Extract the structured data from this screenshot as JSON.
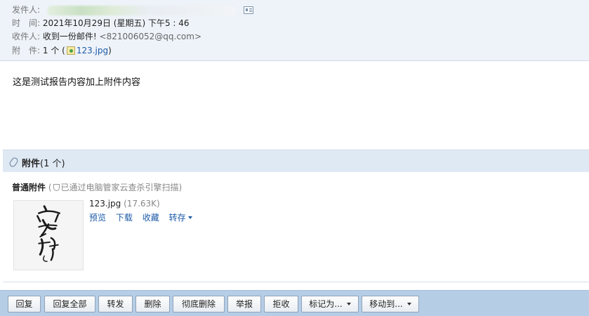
{
  "header": {
    "sender_label": "发件人:",
    "time_label": "时　间:",
    "time_value": "2021年10月29日 (星期五) 下午5 : 46",
    "recipient_label": "收件人:",
    "recipient_name": "收到一份邮件!",
    "recipient_email": "<821006052@qq.com>",
    "attachment_label": "附　件:",
    "attachment_count": "1 个 (",
    "attachment_file": "123.jpg",
    "attachment_close": ")"
  },
  "body": {
    "text": "这是测试报告内容加上附件内容"
  },
  "attachments": {
    "title": "附件",
    "count": "(1 个)",
    "type_label": "普通附件",
    "scan_open": "(",
    "scan_text": "已通过电脑管家云查杀引擎扫描)",
    "file_name": "123.jpg",
    "file_size": "(17.63K)",
    "actions": {
      "preview": "预览",
      "download": "下载",
      "favorite": "收藏",
      "save_to": "转存"
    }
  },
  "toolbar": {
    "reply": "回复",
    "reply_all": "回复全部",
    "forward": "转发",
    "delete": "删除",
    "delete_permanently": "彻底删除",
    "report": "举报",
    "reject": "拒收",
    "mark_as": "标记为...",
    "move_to": "移动到..."
  },
  "colors": {
    "link": "#1d5aa8",
    "header_bg": "#eef3f9",
    "toolbar_bg": "#b6cde6",
    "attachment_bar_bg": "#dfe9f4"
  }
}
